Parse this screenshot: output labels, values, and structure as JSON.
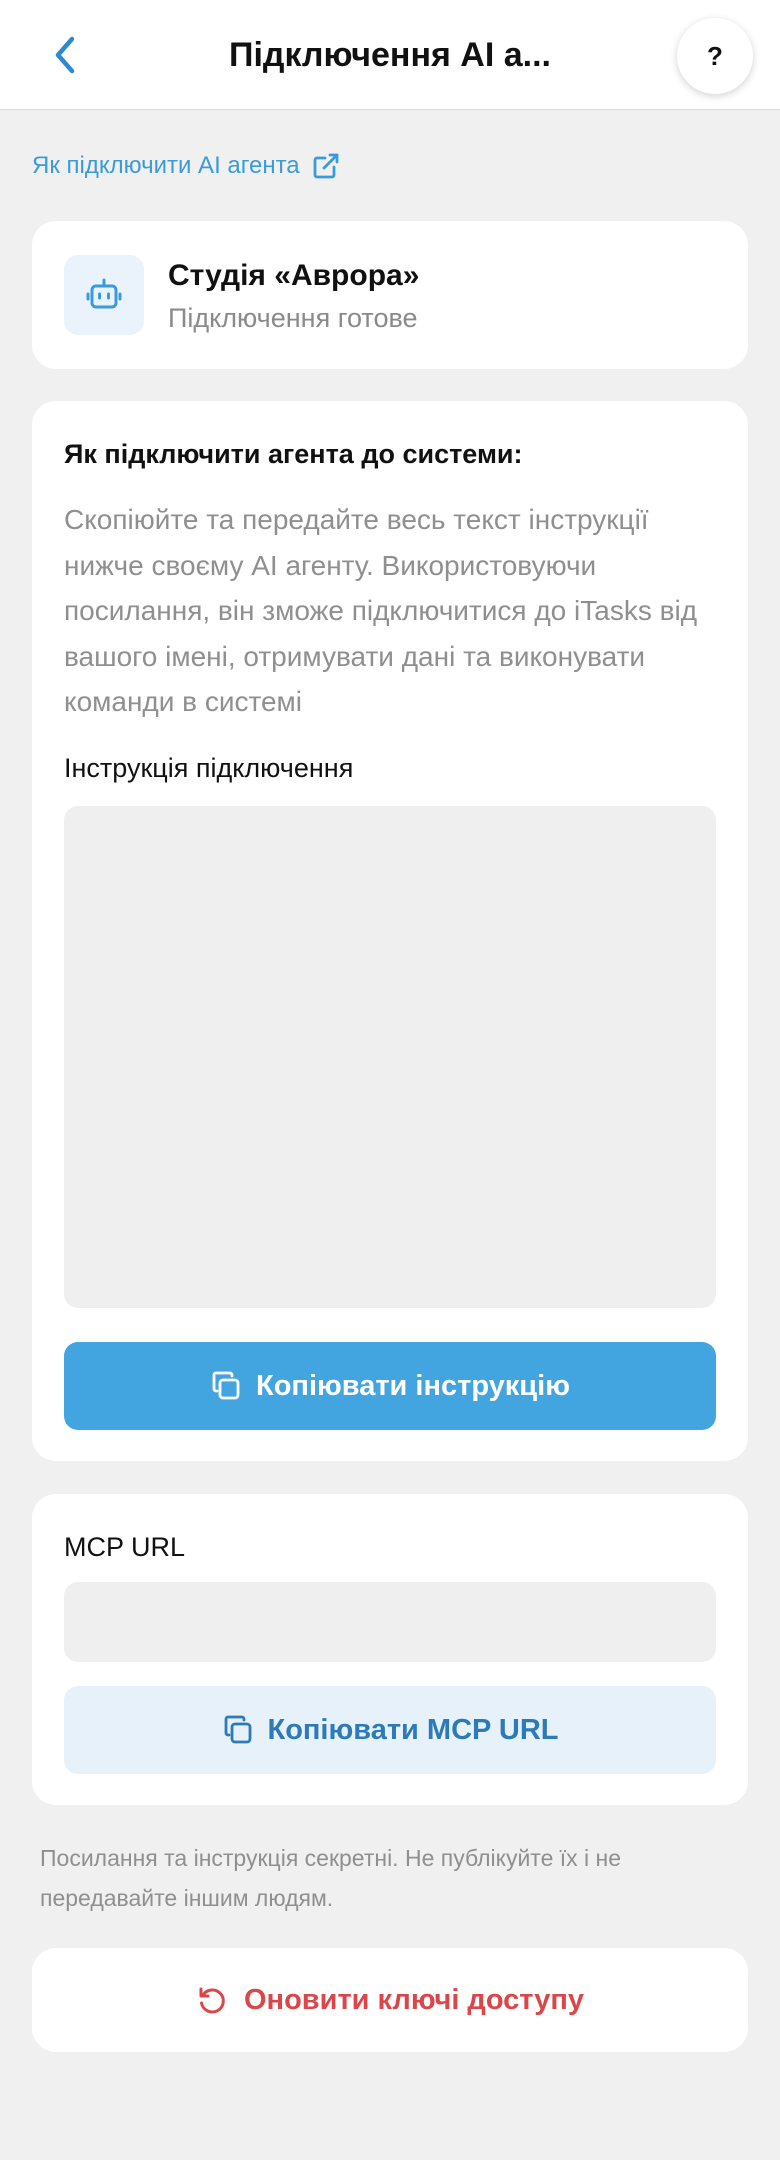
{
  "header": {
    "title": "Підключення AI а...",
    "help_label": "?"
  },
  "howto_link": {
    "label": "Як підключити AI агента"
  },
  "agent": {
    "name": "Студія «Аврора»",
    "status": "Підключення готове"
  },
  "instructions": {
    "heading": "Як підключити агента до системи:",
    "description": "Скопіюйте та передайте весь текст інструкції нижче своєму AI агенту. Використовуючи посилання, він зможе підключитися до iTasks від вашого імені, отримувати дані та виконувати команди в системі",
    "field_label": "Інструкція підключення",
    "field_value": "",
    "copy_button_label": "Копіювати інструкцію"
  },
  "mcp": {
    "label": "MCP URL",
    "value": "",
    "copy_button_label": "Копіювати MCP URL"
  },
  "security_note": "Посилання та інструкція секретні. Не публікуйте їх і не передавайте іншим людям.",
  "refresh_button_label": "Оновити ключі доступу",
  "colors": {
    "accent": "#42a5e0",
    "link": "#3a9bd9",
    "secondary_bg": "#e6f1f9",
    "danger": "#d9474a",
    "page_bg": "#f0f0f0"
  },
  "icons": {
    "back": "chevron-left-icon",
    "external": "external-link-icon",
    "agent": "robot-icon",
    "copy": "copy-icon",
    "refresh": "refresh-icon"
  }
}
